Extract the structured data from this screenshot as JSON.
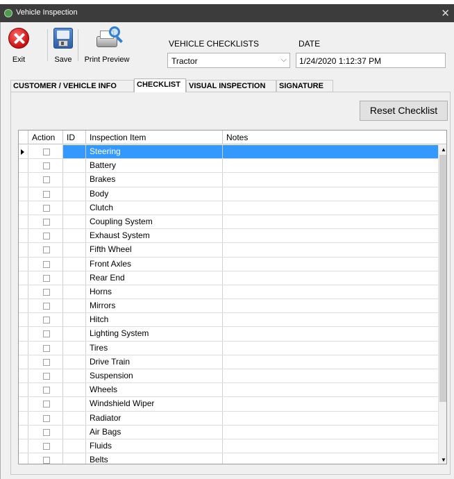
{
  "window": {
    "title": "Vehicle Inspection",
    "close_glyph": "✕"
  },
  "toolbar": {
    "exit_label": "Exit",
    "save_label": "Save",
    "print_preview_label": "Print Preview"
  },
  "checklist_selector": {
    "label": "VEHICLE CHECKLISTS",
    "value": "Tractor"
  },
  "date_field": {
    "label": "DATE",
    "value": "1/24/2020 1:12:37 PM"
  },
  "tabs": [
    {
      "label": "CUSTOMER / VEHICLE INFO",
      "active": false
    },
    {
      "label": "CHECKLIST",
      "active": true
    },
    {
      "label": "VISUAL INSPECTION",
      "active": false
    },
    {
      "label": "SIGNATURE",
      "active": false
    }
  ],
  "reset_button": "Reset Checklist",
  "grid": {
    "columns": [
      "Action",
      "ID",
      "Inspection Item",
      "Notes"
    ],
    "rows": [
      {
        "item": "Steering",
        "checked": false,
        "selected": true
      },
      {
        "item": "Battery",
        "checked": false
      },
      {
        "item": "Brakes",
        "checked": false
      },
      {
        "item": "Body",
        "checked": false
      },
      {
        "item": "Clutch",
        "checked": false
      },
      {
        "item": "Coupling System",
        "checked": false
      },
      {
        "item": "Exhaust System",
        "checked": false
      },
      {
        "item": "Fifth Wheel",
        "checked": false
      },
      {
        "item": "Front Axles",
        "checked": false
      },
      {
        "item": "Rear End",
        "checked": false
      },
      {
        "item": "Horns",
        "checked": false
      },
      {
        "item": "Mirrors",
        "checked": false
      },
      {
        "item": "Hitch",
        "checked": false
      },
      {
        "item": "Lighting System",
        "checked": false
      },
      {
        "item": "Tires",
        "checked": false
      },
      {
        "item": "Drive Train",
        "checked": false
      },
      {
        "item": "Suspension",
        "checked": false
      },
      {
        "item": "Wheels",
        "checked": false
      },
      {
        "item": "Windshield Wiper",
        "checked": false
      },
      {
        "item": "Radiator",
        "checked": false
      },
      {
        "item": "Air Bags",
        "checked": false
      },
      {
        "item": "Fluids",
        "checked": false
      },
      {
        "item": "Belts",
        "checked": false
      }
    ]
  },
  "icons": {
    "app": "app-icon",
    "exit": "exit-icon",
    "save": "save-disk-icon",
    "print_preview": "print-preview-icon"
  }
}
